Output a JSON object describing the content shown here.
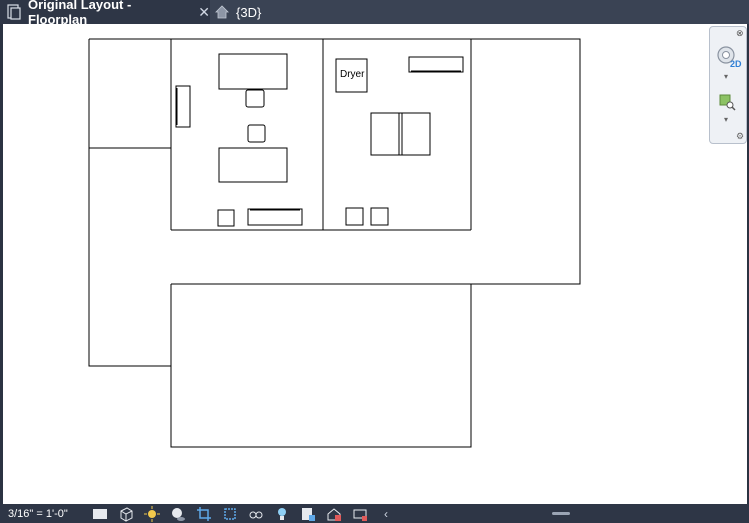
{
  "tabs": [
    {
      "label": "Original Layout - Floorplan",
      "icon": "floorplan-doc-icon",
      "active": true
    },
    {
      "label": "{3D}",
      "icon": "house-icon",
      "active": false
    }
  ],
  "plan": {
    "rooms": [
      {
        "label": "Dryer"
      }
    ]
  },
  "navigation_bar": {
    "badge_2d": "2D"
  },
  "statusbar": {
    "scale": "3/16\" = 1'-0\"",
    "tools": [
      "detail-level-icon",
      "visual-style-cube-icon",
      "sun-path-icon",
      "shadows-icon",
      "crop-view-icon",
      "show-crop-icon",
      "temporary-hide-icon",
      "reveal-hidden-icon",
      "lightbulb-icon",
      "temporary-properties-icon",
      "worksharing-icon",
      "analysis-display-icon",
      "scroll-left-icon"
    ]
  },
  "colors": {
    "tabbar": "#3a4354",
    "statusbar": "#2e3646",
    "canvas": "#ffffff",
    "accent_2d": "#2f7fd6"
  }
}
